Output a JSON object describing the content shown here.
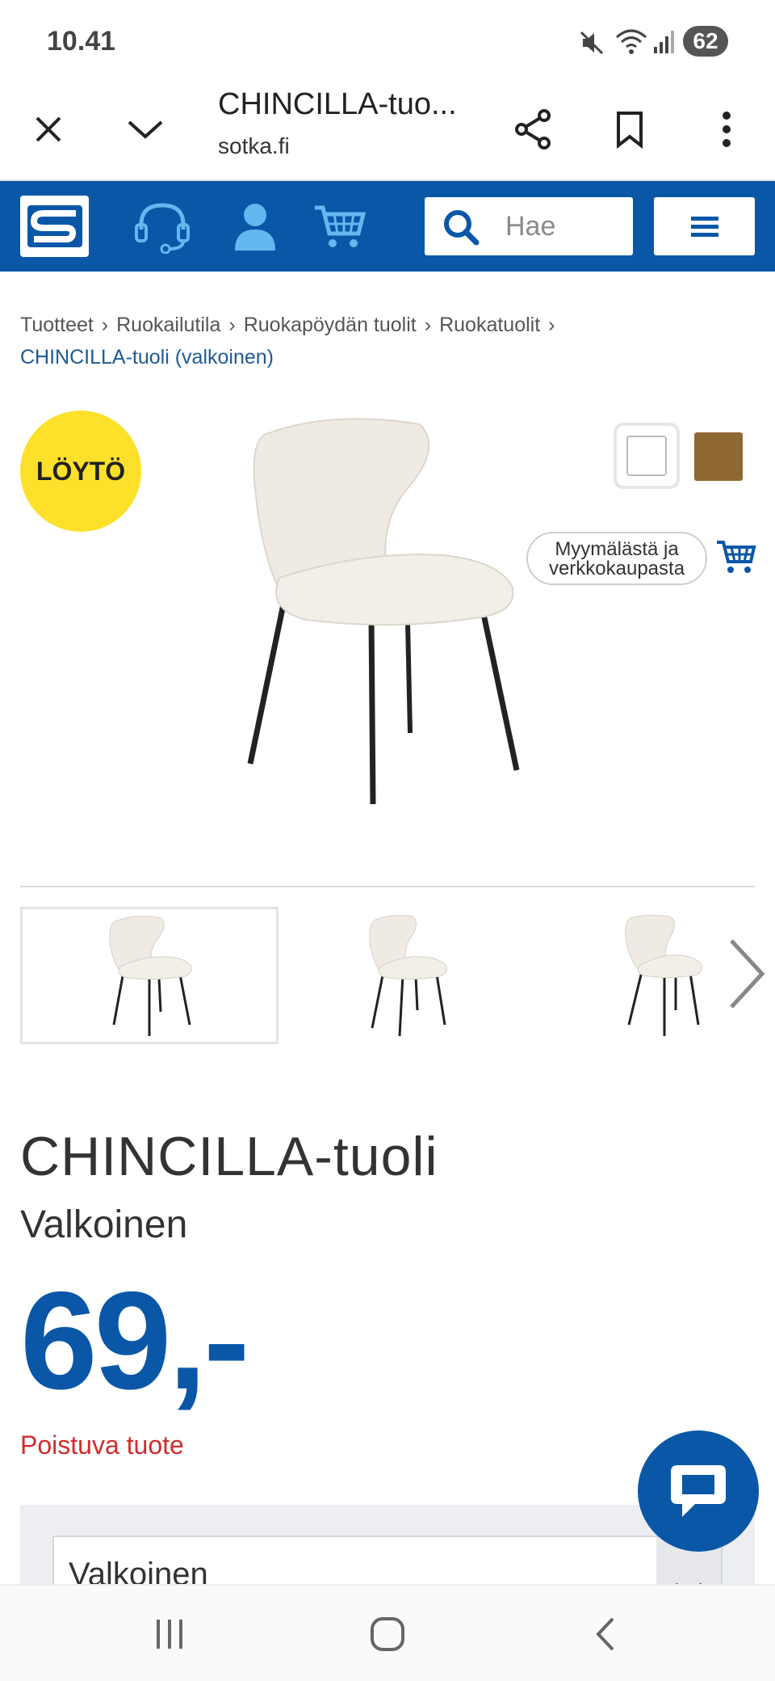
{
  "status_bar": {
    "time": "10.41",
    "battery": "62"
  },
  "browser": {
    "title": "CHINCILLA-tuo...",
    "domain": "sotka.fi"
  },
  "site": {
    "search_placeholder": "Hae",
    "brand_color": "#0a57a8"
  },
  "breadcrumb": {
    "items": [
      "Tuotteet",
      "Ruokailutila",
      "Ruokapöydän tuolit",
      "Ruokatuolit"
    ],
    "separator": "›",
    "current": "CHINCILLA-tuoli (valkoinen)"
  },
  "product": {
    "badge": "LÖYTÖ",
    "availability": "Myymälästä ja verkkokaupasta",
    "name": "CHINCILLA-tuoli",
    "color": "Valkoinen",
    "price": "69,-",
    "status": "Poistuva tuote",
    "swatches": [
      {
        "name": "valkoinen",
        "color": "#ffffff",
        "selected": true
      },
      {
        "name": "ruskea",
        "color": "#8f6732",
        "selected": false
      }
    ],
    "variant_select": {
      "value": "Valkoinen"
    }
  }
}
